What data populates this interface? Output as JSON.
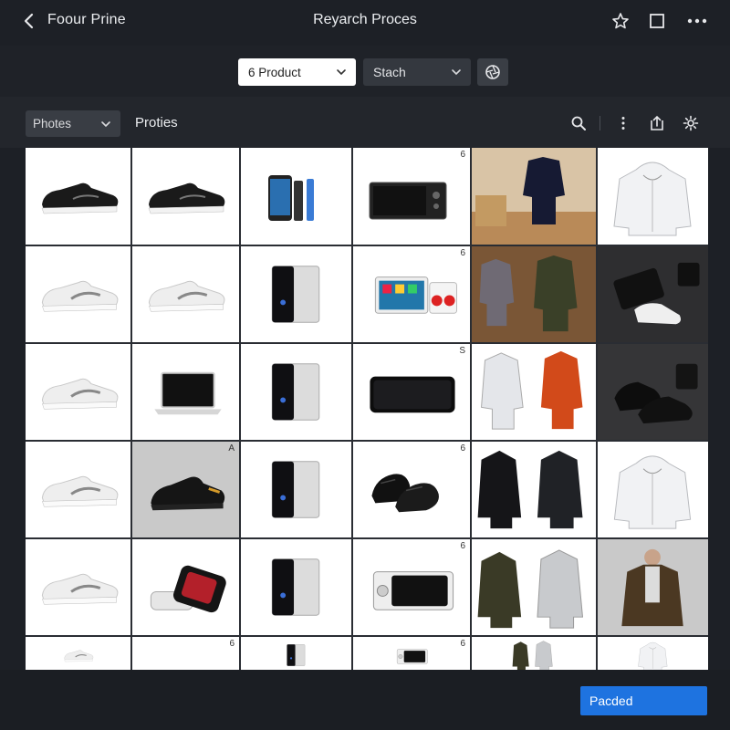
{
  "window": {
    "app_title": "Foour Prine",
    "title": "Reyarch Proces",
    "icons": [
      "back-icon",
      "star-icon",
      "square-icon",
      "more-icon"
    ]
  },
  "filters": {
    "product_select": "6 Product",
    "stash_select": "Stach",
    "filter_icon": "aperture-icon"
  },
  "toolbar": {
    "photos_select": "Photes",
    "section_title": "Proties",
    "icons": [
      "search-icon",
      "kebab-icon",
      "upload-icon",
      "gear-icon"
    ]
  },
  "grid": {
    "columns": 6,
    "rows_visible": 6,
    "cells": [
      [
        {
          "type": "sneaker-black"
        },
        {
          "type": "sneaker-black"
        },
        {
          "type": "phone"
        },
        {
          "type": "tv"
        },
        {
          "type": "jacket-scene"
        },
        {
          "type": "hoodie-white"
        }
      ],
      [
        {
          "type": "sneaker-white"
        },
        {
          "type": "sneaker-white"
        },
        {
          "type": "cube-device"
        },
        {
          "type": "tablet-set"
        },
        {
          "type": "jacket-pair-wood"
        },
        {
          "type": "device-dark"
        }
      ],
      [
        {
          "type": "sneaker-white"
        },
        {
          "type": "laptop"
        },
        {
          "type": "cube-device"
        },
        {
          "type": "phone-black"
        },
        {
          "type": "jacket-pair-red"
        },
        {
          "type": "boots-dark"
        }
      ],
      [
        {
          "type": "sneaker-white"
        },
        {
          "type": "sneaker-black-gray"
        },
        {
          "type": "cube-device"
        },
        {
          "type": "sneaker-pair-black"
        },
        {
          "type": "jacket-pair-black"
        },
        {
          "type": "hoodie-white"
        }
      ],
      [
        {
          "type": "sneaker-white"
        },
        {
          "type": "band-device"
        },
        {
          "type": "cube-device"
        },
        {
          "type": "camera-white"
        },
        {
          "type": "jacket-pair-gray"
        },
        {
          "type": "cardigan-man"
        }
      ],
      [
        {
          "type": "sneaker-white"
        },
        {
          "type": "blank"
        },
        {
          "type": "cube-device"
        },
        {
          "type": "camera-white"
        },
        {
          "type": "jacket-pair-gray"
        },
        {
          "type": "hoodie-white"
        }
      ]
    ],
    "corner_marks": [
      {
        "row": 0,
        "col": 3,
        "text": "6"
      },
      {
        "row": 1,
        "col": 3,
        "text": "6"
      },
      {
        "row": 2,
        "col": 3,
        "text": "S"
      },
      {
        "row": 3,
        "col": 1,
        "text": "A"
      },
      {
        "row": 3,
        "col": 3,
        "text": "6"
      },
      {
        "row": 4,
        "col": 3,
        "text": "6"
      },
      {
        "row": 5,
        "col": 1,
        "text": "6"
      },
      {
        "row": 5,
        "col": 3,
        "text": "6"
      }
    ]
  },
  "footer": {
    "primary_button": "Pacded"
  },
  "colors": {
    "background": "#1d2026",
    "accent": "#1e73e0",
    "panel": "#23262c"
  }
}
